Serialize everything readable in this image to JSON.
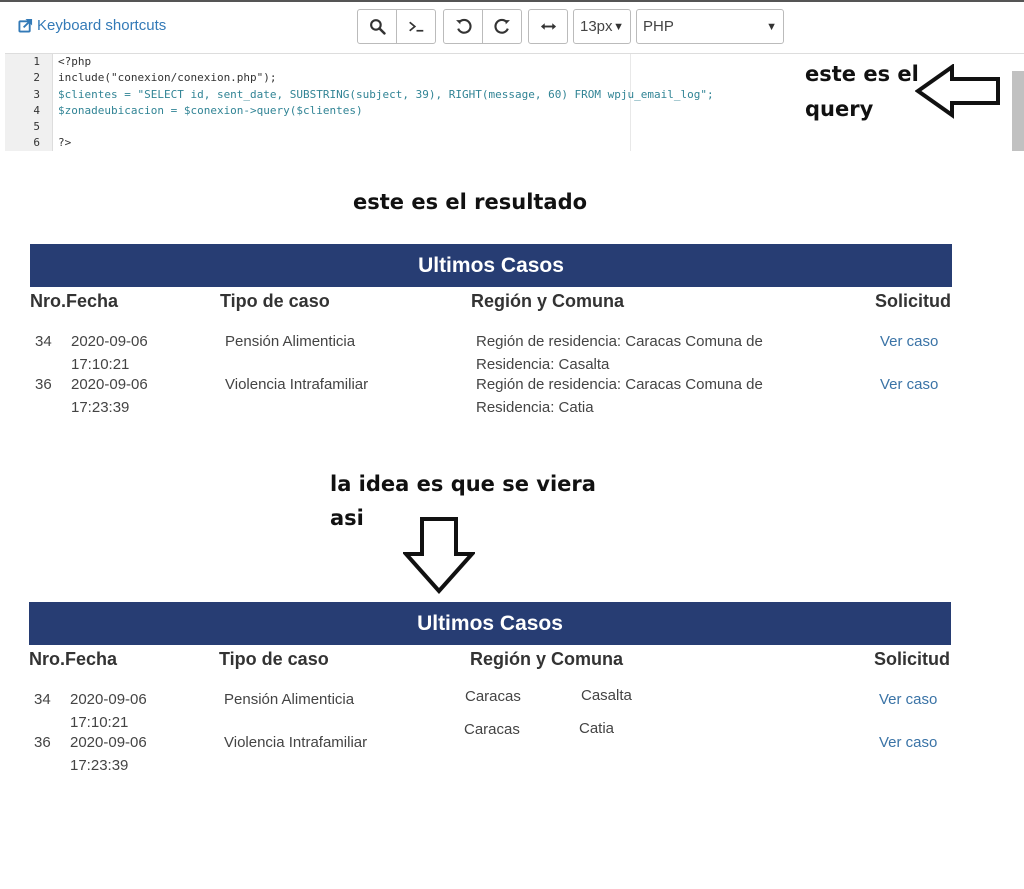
{
  "toolbar": {
    "keyboard_shortcuts": "Keyboard shortcuts",
    "font_size": "13px",
    "language": "PHP",
    "icons": [
      "external-link-icon",
      "search-icon",
      "terminal-icon",
      "undo-icon",
      "redo-icon",
      "wrap-icon",
      "chevron-down-icon"
    ]
  },
  "editor": {
    "line_numbers": [
      "1",
      "2",
      "3",
      "4",
      "5",
      "6"
    ],
    "lines": [
      "<?php",
      "include(\"conexion/conexion.php\");",
      "$clientes = \"SELECT id, sent_date, SUBSTRING(subject, 39), RIGHT(message, 60) FROM wpju_email_log\";",
      "$zonadeubicacion = $conexion->query($clientes)",
      "",
      "?>"
    ]
  },
  "annotations": {
    "query_note": "este es el query",
    "result_note": "este es el resultado",
    "idea_note_line1": "la idea es que se viera",
    "idea_note_line2": "asi"
  },
  "table_actual": {
    "title": "Ultimos Casos",
    "headers": [
      "Nro.",
      "Fecha",
      "Tipo de caso",
      "Región y Comuna",
      "Solicitud"
    ],
    "rows": [
      {
        "nro": "34",
        "fecha_d": "2020-09-06",
        "fecha_t": "17:10:21",
        "tipo": "Pensión Alimenticia",
        "region_1": "Región de residencia: Caracas Comuna de",
        "region_2": "Residencia: Casalta",
        "solicitud": "Ver caso"
      },
      {
        "nro": "36",
        "fecha_d": "2020-09-06",
        "fecha_t": "17:23:39",
        "tipo": "Violencia Intrafamiliar",
        "region_1": "Región de residencia: Caracas Comuna de",
        "region_2": "Residencia: Catia",
        "solicitud": "Ver caso"
      }
    ]
  },
  "table_expected": {
    "title": "Ultimos Casos",
    "headers": [
      "Nro.",
      "Fecha",
      "Tipo de caso",
      "Región y Comuna",
      "Solicitud"
    ],
    "rows": [
      {
        "nro": "34",
        "fecha_d": "2020-09-06",
        "fecha_t": "17:10:21",
        "tipo": "Pensión Alimenticia",
        "region": "Caracas",
        "comuna": "Casalta",
        "solicitud": "Ver caso"
      },
      {
        "nro": "36",
        "fecha_d": "2020-09-06",
        "fecha_t": "17:23:39",
        "tipo": "Violencia Intrafamiliar",
        "region": "Caracas",
        "comuna": "Catia",
        "solicitud": "Ver caso"
      }
    ]
  },
  "colors": {
    "table_header_bg": "#273d73",
    "link": "#3a73a6",
    "toolbar_link": "#337ab7"
  }
}
